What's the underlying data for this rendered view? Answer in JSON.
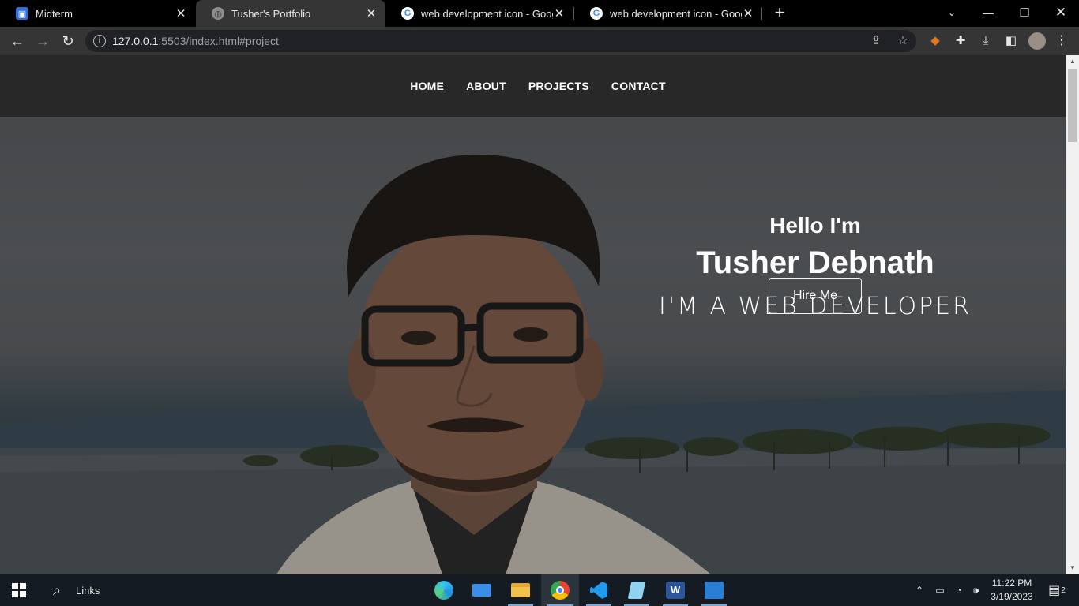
{
  "browser": {
    "tabs": [
      {
        "title": "Midterm",
        "icon": "google-classroom-icon",
        "active": false
      },
      {
        "title": "Tusher's Portfolio",
        "icon": "globe-icon",
        "active": true
      },
      {
        "title": "web development icon - Google",
        "icon": "google-icon",
        "active": false
      },
      {
        "title": "web development icon - Google",
        "icon": "google-icon",
        "active": false
      }
    ],
    "address": {
      "host": "127.0.0.1",
      "rest": ":5503/index.html#project"
    }
  },
  "site": {
    "nav": [
      "HOME",
      "ABOUT",
      "PROJECTS",
      "CONTACT"
    ],
    "hero": {
      "greeting": "Hello I'm",
      "name": "Tusher Debnath",
      "role": "I'M A WEB DEVELOPER",
      "cta": "Hire Me"
    }
  },
  "taskbar": {
    "search_label": "Links",
    "apps": [
      "edge-icon",
      "mail-icon",
      "file-explorer-icon",
      "chrome-icon",
      "vscode-icon",
      "notepad-icon",
      "word-icon",
      "photos-icon"
    ],
    "time": "11:22 PM",
    "date": "3/19/2023",
    "notification_count": "2"
  },
  "colors": {
    "tab_strip": "#000000",
    "toolbar": "#353535",
    "site_nav": "#282828",
    "taskbar": "#151b22"
  }
}
